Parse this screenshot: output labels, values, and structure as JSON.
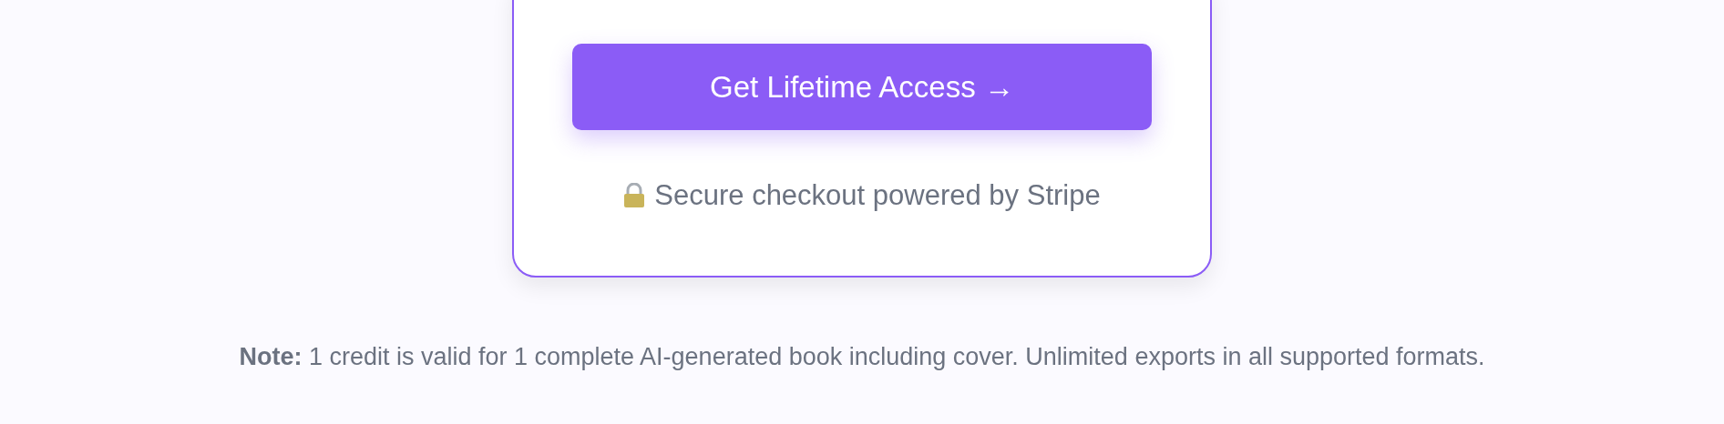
{
  "card": {
    "button": "Get Lifetime Access →",
    "secure_note": "Secure checkout powered by Stripe"
  },
  "footnote": "**Note:** 1 credit is valid for 1 complete AI-generated book including cover. Unlimited exports in all supported formats."
}
